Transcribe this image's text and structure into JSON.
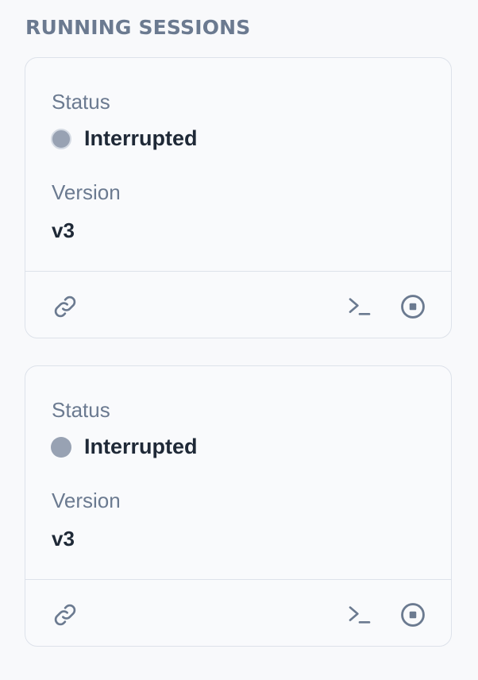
{
  "section": {
    "title": "RUNNING SESSIONS"
  },
  "colors": {
    "muted_text": "#6b7a90",
    "strong_text": "#1f2937",
    "status_interrupted": "#98a2b3",
    "border": "#dde2ea"
  },
  "sessions": [
    {
      "status_label": "Status",
      "status_value": "Interrupted",
      "status_color": "#98a2b3",
      "version_label": "Version",
      "version_value": "v3",
      "actions": [
        "link-icon",
        "terminal-icon",
        "stop-icon"
      ]
    },
    {
      "status_label": "Status",
      "status_value": "Interrupted",
      "status_color": "#98a2b3",
      "version_label": "Version",
      "version_value": "v3",
      "actions": [
        "link-icon",
        "terminal-icon",
        "stop-icon"
      ]
    }
  ]
}
